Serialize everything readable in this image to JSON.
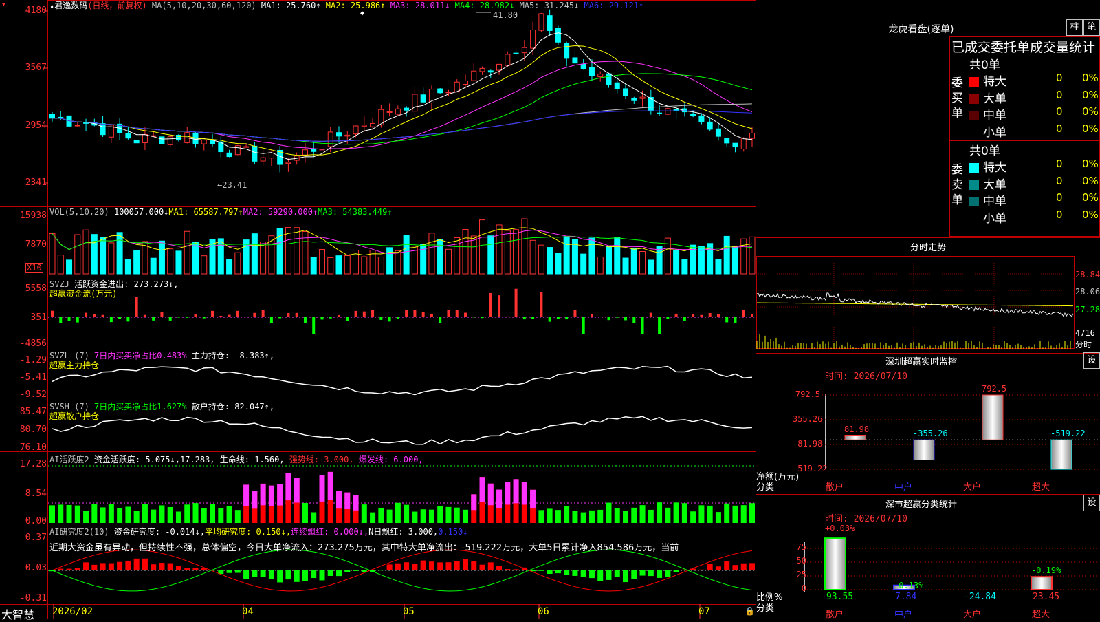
{
  "main": {
    "stock_name": "★君逸数码",
    "period": "(日线，前复权)",
    "ma_title": "MA(5,10,20,30,60,120)",
    "ma_values": [
      {
        "label": "MA1: 25.760↑",
        "color": "#ffffff"
      },
      {
        "label": "MA2: 25.986↑",
        "color": "#ffff00"
      },
      {
        "label": "MA3: 28.011↓",
        "color": "#ff33ff"
      },
      {
        "label": "MA4: 28.982↓",
        "color": "#00ff00"
      },
      {
        "label": "MA5: 31.245↓",
        "color": "#c0c0c0"
      },
      {
        "label": "MA6: 29.121↑",
        "color": "#3232ff"
      }
    ],
    "y_labels": [
      "4180",
      "3567",
      "2954",
      "2341"
    ],
    "high_label": "41.80",
    "low_label": "←23.41"
  },
  "vol": {
    "title": "VOL(5,10,20)",
    "value": "100057.000↓",
    "ma1": "MA1: 65587.797↑",
    "ma2": "MA2: 59290.000↑",
    "ma3": "MA3: 54383.449↑",
    "y_labels": [
      "15938",
      "7870"
    ],
    "unit": "X10"
  },
  "svzj": {
    "title": "SVZJ",
    "desc": "活跃资金进出: 273.273↓,",
    "name": "超赢资金流(万元)",
    "y_labels": [
      "5558",
      "351",
      "-4856"
    ]
  },
  "svzl": {
    "title": "SVZL (7)",
    "desc": "7日内买卖净占比0.483%",
    "desc2": "主力持仓: -8.383↑,",
    "name": "超赢主力持仓",
    "y_labels": [
      "-1.29",
      "-5.41",
      "-9.52"
    ]
  },
  "svsh": {
    "title": "SVSH (7)",
    "desc": "7日内买卖净占比1.627%",
    "desc2": "散户持仓: 82.047↑,",
    "name": "超赢散户持仓",
    "y_labels": [
      "85.47",
      "80.70",
      "76.10"
    ]
  },
  "ai1": {
    "title": "AI活跃度2",
    "desc": "资金活跃度: 5.075↓,17.283,",
    "life": "生命线: 1.560,",
    "strong": "强势线: 3.000,",
    "burst": "爆发线: 6.000,",
    "y_labels": [
      "17.28",
      "8.54",
      "0.00"
    ]
  },
  "ai2": {
    "title": "AI研究度2(10)",
    "desc": "资金研究度: -0.014↓,",
    "avg": "平均研究度: 0.150↓,",
    "cont": "连续飘红: 0.000↓,",
    "nday": "N日飘红: 3.000,",
    "last": "0.150↓",
    "comment": "近期大资金虽有异动，但持续性不强，总体偏空，今日大单净流入：273.275万元，其中特大单净流出：-519.222万元，大单5日累计净入854.586万元，当前",
    "y_labels": [
      "0.37",
      "0.03",
      "-0.31"
    ]
  },
  "xaxis": {
    "labels": [
      "2026/02",
      "04",
      "05",
      "06",
      "07"
    ],
    "brand": "大智慧"
  },
  "lhb": {
    "title": "龙虎看盘(逐单)",
    "btn1": "柱",
    "btn2": "笔",
    "subtitle": "已成交委托单成交量统计",
    "buy_side": "委买单",
    "sell_side": "委卖单",
    "buy_total": "共0单",
    "sell_total": "共0单",
    "buy_rows": [
      {
        "label": "特大",
        "count": "0",
        "pct": "0%",
        "color": "#ff0000"
      },
      {
        "label": "大单",
        "count": "0",
        "pct": "0%",
        "color": "#8b0000"
      },
      {
        "label": "中单",
        "count": "0",
        "pct": "0%",
        "color": "#5a0000"
      },
      {
        "label": "小单",
        "count": "0",
        "pct": "0%",
        "color": ""
      }
    ],
    "sell_rows": [
      {
        "label": "特大",
        "count": "0",
        "pct": "0%",
        "color": "#00ffff"
      },
      {
        "label": "大单",
        "count": "0",
        "pct": "0%",
        "color": "#008b8b"
      },
      {
        "label": "中单",
        "count": "0",
        "pct": "0%",
        "color": "#007070"
      },
      {
        "label": "小单",
        "count": "0",
        "pct": "0%",
        "color": ""
      }
    ]
  },
  "fenshi": {
    "title": "分时走势",
    "y_labels": [
      "28.84",
      "28.06",
      "27.28"
    ],
    "vol_label": "4716",
    "vol_unit": "分时"
  },
  "monitor": {
    "title": "深圳超赢实时监控",
    "btn": "设",
    "time": "时间: 2026/07/10",
    "y_labels": [
      "792.5",
      "355.26",
      "-81.98",
      "-519.22"
    ],
    "axis_title": "净额(万元)",
    "axis_sub": "分类",
    "categories": [
      "散户",
      "中户",
      "大户",
      "超大"
    ],
    "values_label": [
      "81.98",
      "-355.26",
      "792.5",
      "-519.22"
    ]
  },
  "stats": {
    "title": "深市超赢分类统计",
    "btn": "设",
    "time": "时间: 2026/07/10",
    "y_labels": [
      "75",
      "50",
      "25",
      "0"
    ],
    "axis_title": "比例%",
    "axis_sub": "分类",
    "categories": [
      "散户",
      "中户",
      "大户",
      "超大"
    ],
    "top_labels": [
      "+0.03%",
      "-0.13%",
      "",
      "-0.19%"
    ],
    "bottom_values": [
      "93.55",
      "7.84",
      "-24.84",
      "23.45"
    ]
  },
  "chart_data": [
    {
      "type": "bar",
      "title": "深圳超赢实时监控",
      "ylabel": "净额(万元)",
      "categories": [
        "散户",
        "中户",
        "大户",
        "超大"
      ],
      "values": [
        81.98,
        -355.26,
        792.5,
        -519.22
      ],
      "ylim": [
        -519.22,
        792.5
      ]
    },
    {
      "type": "bar",
      "title": "深市超赢分类统计",
      "ylabel": "比例%",
      "categories": [
        "散户",
        "中户",
        "大户",
        "超大"
      ],
      "values": [
        93.55,
        7.84,
        -24.84,
        23.45
      ],
      "ylim": [
        0,
        100
      ]
    }
  ]
}
